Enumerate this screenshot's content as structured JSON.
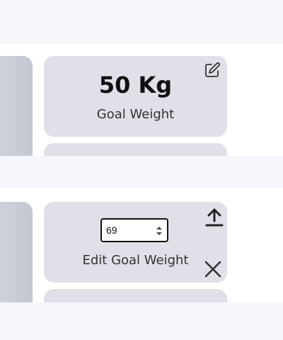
{
  "goal_card": {
    "value": "50 Kg",
    "caption": "Goal Weight",
    "icon": "edit-icon"
  },
  "edit_card": {
    "input_value": "69",
    "caption": "Edit Goal Weight",
    "icons": [
      "upload-icon",
      "close-icon",
      "stepper-icon"
    ]
  },
  "colors": {
    "page_bg": "#f6f7fc",
    "card_bg": "#e1e0e8",
    "text": "#111111"
  }
}
